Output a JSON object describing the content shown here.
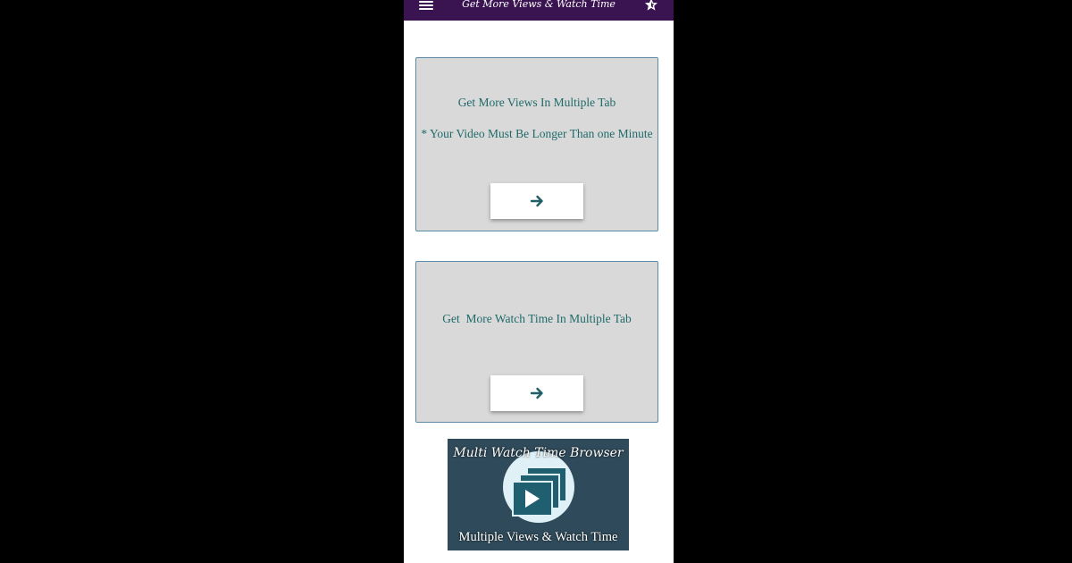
{
  "app_bar": {
    "title": "Get More Views & Watch Time",
    "menu_icon": "hamburger-menu-icon",
    "rate_icon": "star-rate-icon",
    "background": "#3a1450"
  },
  "cards": [
    {
      "line1": "Get More Views In Multiple Tab",
      "line2": "* Your Video Must Be Longer Than one Minute",
      "button_icon": "arrow-right-icon"
    },
    {
      "line1": "Get  More Watch Time In Multiple Tab",
      "button_icon": "arrow-right-icon"
    }
  ],
  "banner": {
    "title": "Multi Watch Time Browser",
    "subtitle": "Multiple Views & Watch Time",
    "icon": "stacked-video-play-icon",
    "background": "#2f4a5a"
  },
  "colors": {
    "card_text": "#1f6a6a",
    "card_background": "#d9d9d9",
    "card_border": "#5d8aa8"
  }
}
